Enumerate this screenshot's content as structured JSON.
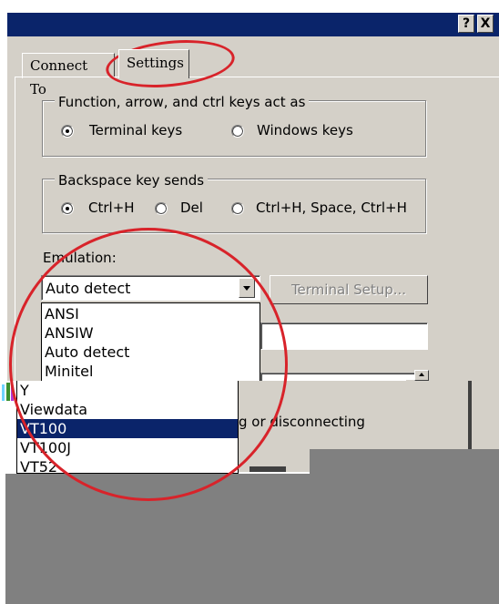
{
  "window": {
    "help_btn": "?",
    "close_btn": "X"
  },
  "tabs": [
    {
      "label": "Connect To"
    },
    {
      "label": "Settings"
    }
  ],
  "function_keys": {
    "legend": "Function, arrow, and ctrl keys act as",
    "options": [
      "Terminal keys",
      "Windows keys"
    ],
    "selected": "Terminal keys"
  },
  "backspace": {
    "legend": "Backspace key sends",
    "options": [
      "Ctrl+H",
      "Del",
      "Ctrl+H, Space, Ctrl+H"
    ],
    "selected": "Ctrl+H"
  },
  "emulation": {
    "label": "Emulation:",
    "value": "Auto detect",
    "terminal_setup_label": "Terminal Setup...",
    "options": [
      "ANSI",
      "ANSIW",
      "Auto detect",
      "Minitel",
      "Y",
      "Viewdata",
      "VT100",
      "VT100J",
      "VT52"
    ],
    "highlighted": "VT100"
  },
  "partial_text": {
    "disconnecting": "g or disconnecting"
  },
  "colors": {
    "title_bar": "#0a246a",
    "dialog_face": "#d4d0c8",
    "selection": "#0a246a",
    "annotation_red": "#d8232a"
  }
}
